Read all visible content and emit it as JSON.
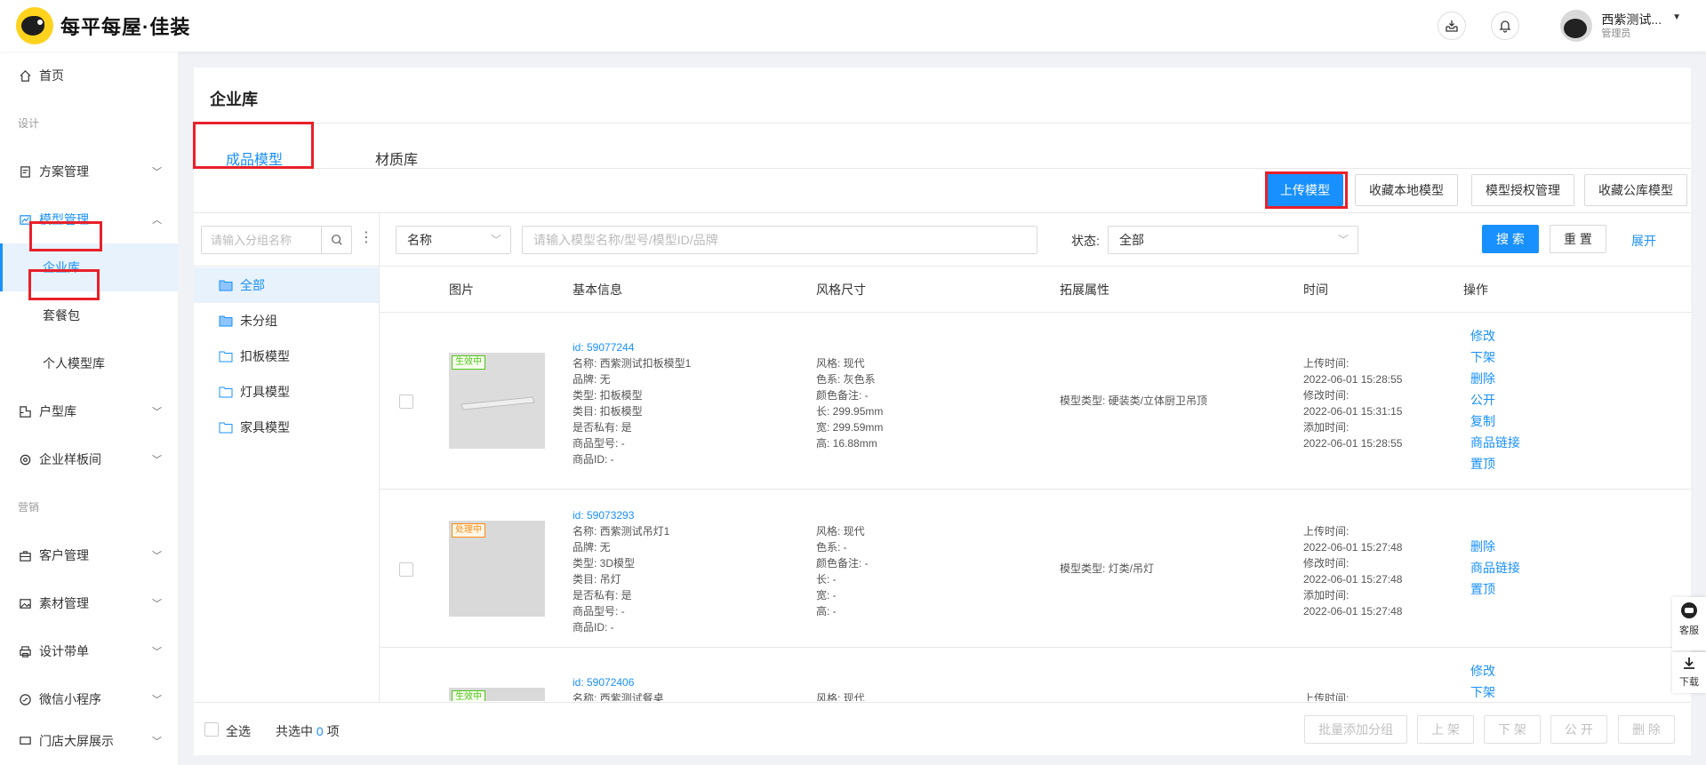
{
  "header": {
    "logo_text": "每平每屋·佳装",
    "user_name": "西紫测试...",
    "user_role": "管理员"
  },
  "sidebar": {
    "home": "首页",
    "section_design": "设计",
    "plan_mgmt": "方案管理",
    "model_mgmt": "模型管理",
    "enterprise_lib": "企业库",
    "package": "套餐包",
    "personal_lib": "个人模型库",
    "house_lib": "户型库",
    "sample_room": "企业样板间",
    "section_marketing": "营销",
    "customer_mgmt": "客户管理",
    "material_mgmt": "素材管理",
    "design_order": "设计带单",
    "wechat_app": "微信小程序",
    "store_display": "门店大屏展示"
  },
  "main": {
    "title": "企业库",
    "tabs": [
      "成品模型",
      "材质库"
    ],
    "actions": [
      "上传模型",
      "收藏本地模型",
      "模型授权管理",
      "收藏公库模型"
    ]
  },
  "groups": {
    "search_placeholder": "请输入分组名称",
    "items": [
      "全部",
      "未分组",
      "扣板模型",
      "灯具模型",
      "家具模型"
    ]
  },
  "filters": {
    "field_select": "名称",
    "keyword_placeholder": "请输入模型名称/型号/模型ID/品牌",
    "status_label": "状态:",
    "status_value": "全部",
    "search": "搜 索",
    "reset": "重 置",
    "expand": "展开"
  },
  "table": {
    "columns": [
      "图片",
      "基本信息",
      "风格尺寸",
      "拓展属性",
      "时间",
      "操作"
    ],
    "rows": [
      {
        "badge": "生效中",
        "info": [
          "id:  59077244",
          "名称:  西紫测试扣板模型1",
          "品牌:  无",
          "类型:  扣板模型",
          "类目:  扣板模型",
          "是否私有:  是",
          "商品型号:  -",
          "商品ID:  -"
        ],
        "style": [
          "风格:  现代",
          "色系:  灰色系",
          "颜色备注:  -",
          "长:  299.95mm",
          "宽:  299.59mm",
          "高:  16.88mm"
        ],
        "ext": "模型类型:  硬装类/立体厨卫吊顶",
        "time": [
          "上传时间:",
          "2022-06-01 15:28:55",
          "修改时间:",
          "2022-06-01 15:31:15",
          "添加时间:",
          "2022-06-01 15:28:55"
        ],
        "ops": [
          "修改",
          "下架",
          "删除",
          "公开",
          "复制",
          "商品链接",
          "置顶"
        ]
      },
      {
        "badge": "处理中",
        "info": [
          "id:  59073293",
          "名称:  西紫测试吊灯1",
          "品牌:  无",
          "类型:  3D模型",
          "类目:  吊灯",
          "是否私有:  是",
          "商品型号:  -",
          "商品ID:  -"
        ],
        "style": [
          "风格:  现代",
          "色系:  -",
          "颜色备注:  -",
          "长:  -",
          "宽:  -",
          "高:  -"
        ],
        "ext": "模型类型:  灯类/吊灯",
        "time": [
          "上传时间:",
          "2022-06-01 15:27:48",
          "修改时间:",
          "2022-06-01 15:27:48",
          "添加时间:",
          "2022-06-01 15:27:48"
        ],
        "ops": [
          "删除",
          "商品链接",
          "置顶"
        ]
      },
      {
        "badge": "生效中",
        "info": [
          "id:  59072406",
          "名称:  西紫测试餐桌"
        ],
        "style": [
          "风格:  现代"
        ],
        "ext": "",
        "time": [
          "上传时间:"
        ],
        "ops": [
          "修改",
          "下架"
        ]
      }
    ]
  },
  "footer": {
    "select_all": "全选",
    "selected_prefix": "共选中",
    "selected_count": "0",
    "selected_suffix": "项",
    "batch_group": "批量添加分组",
    "up": "上 架",
    "down": "下 架",
    "public": "公 开",
    "delete": "删 除"
  },
  "float": {
    "service": "客服",
    "download": "下载"
  }
}
